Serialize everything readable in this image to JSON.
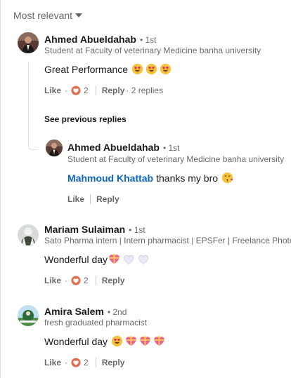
{
  "sort": {
    "label": "Most relevant"
  },
  "actions_text": {
    "like": "Like",
    "reply": "Reply",
    "dot": "·"
  },
  "colors": {
    "reaction_love": "#df704d",
    "mention_blue": "#0a66c2",
    "separator": "#e0dfdc"
  },
  "comments": [
    {
      "author": "Ahmed Abueldahab",
      "degree": "• 1st",
      "headline": "Student at Faculty of veterinary Medicine banha university",
      "text": "Great Performance",
      "emojis": [
        "heart-eyes-emoji",
        "heart-eyes-emoji",
        "heart-eyes-emoji"
      ],
      "reaction_icon": "heart-reaction-icon",
      "reaction_count": "2",
      "replies_count": "· 2 replies"
    },
    {
      "author": "Mariam Sulaiman",
      "degree": "• 1st",
      "headline": "Sato Pharma intern | Intern pharmacist | EPSFer | Freelance Photog",
      "text": "Wonderful day",
      "emojis": [
        "gift-heart-emoji",
        "white-heart-emoji",
        "white-heart-emoji"
      ],
      "reaction_icon": "heart-reaction-icon",
      "reaction_count": "2"
    },
    {
      "author": "Amira Salem",
      "degree": "• 2nd",
      "headline": "fresh graduated pharmacist",
      "text": "Wonderful day",
      "emojis": [
        "heart-eyes-emoji",
        "gift-heart-emoji",
        "gift-heart-emoji",
        "gift-heart-emoji"
      ],
      "reaction_icon": "heart-reaction-icon",
      "reaction_count": "2"
    }
  ],
  "see_previous": "See previous replies",
  "reply": {
    "author": "Ahmed Abueldahab",
    "degree": "• 1st",
    "headline": "Student at Faculty of veterinary Medicine banha university",
    "mention": "Mahmoud Khattab",
    "text": "thanks my bro",
    "emoji": "kiss-emoji"
  }
}
